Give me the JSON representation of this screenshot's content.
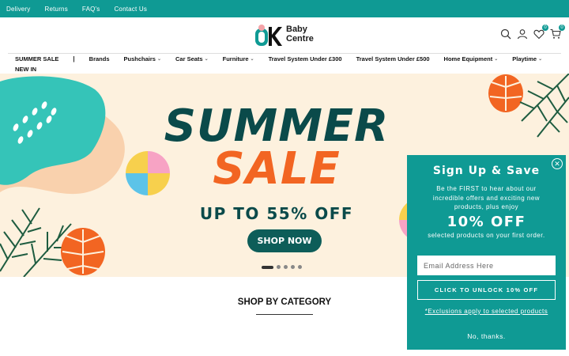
{
  "topbar": {
    "links": [
      "Delivery",
      "Returns",
      "FAQ's",
      "Contact Us"
    ]
  },
  "logo": {
    "line1": "Baby",
    "line2": "Centre"
  },
  "header": {
    "wishlist_count": "0",
    "cart_count": "0"
  },
  "nav": {
    "items": [
      {
        "label": "SUMMER SALE",
        "dropdown": false
      },
      {
        "label": "Brands",
        "dropdown": false
      },
      {
        "label": "Pushchairs",
        "dropdown": true
      },
      {
        "label": "Car Seats",
        "dropdown": true
      },
      {
        "label": "Furniture",
        "dropdown": true
      },
      {
        "label": "Travel System Under £300",
        "dropdown": false
      },
      {
        "label": "Travel System Under £500",
        "dropdown": false
      },
      {
        "label": "Home Equipment",
        "dropdown": true
      },
      {
        "label": "Playtime",
        "dropdown": true
      }
    ],
    "separator": "|",
    "second_row": "NEW IN"
  },
  "hero": {
    "line1": "SUMMER",
    "line2": "SALE",
    "subtitle": "UP TO 55% OFF",
    "cta": "SHOP NOW",
    "slides": 5,
    "active_slide": 1
  },
  "category": {
    "title": "SHOP BY CATEGORY"
  },
  "popup": {
    "title": "Sign Up & Save",
    "description": "Be the FIRST to hear about our incredible offers and exciting new products, plus enjoy",
    "offer": "10% OFF",
    "offer_sub": "selected products on your first order.",
    "email_placeholder": "Email Address Here",
    "button": "CLICK TO UNLOCK 10% OFF",
    "exclusions": "*Exclusions apply to selected products",
    "decline": "No, thanks."
  },
  "colors": {
    "teal": "#0f9a94",
    "dark_teal": "#0a4a4a",
    "orange": "#f26522",
    "cream": "#fdf1de"
  }
}
